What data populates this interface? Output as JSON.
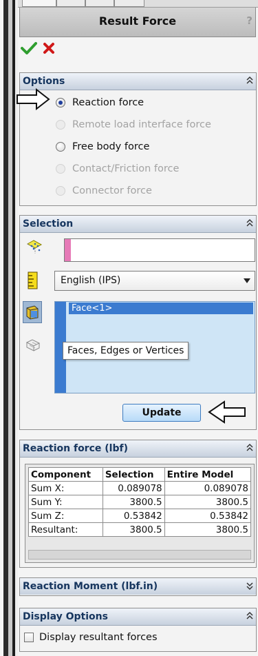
{
  "title_bar": {
    "title": "Result Force",
    "help": "?"
  },
  "actions": {
    "ok": "ok-check-icon",
    "cancel": "cancel-x-icon"
  },
  "colors": {
    "ok": "#2f9e2f",
    "cancel": "#d01818",
    "header_text": "#16355e",
    "list_selected": "#3b7bd0",
    "list_bg": "#cfe5f6",
    "pink": "#e67ab7"
  },
  "options": {
    "header": "Options",
    "items": [
      {
        "label": "Reaction force",
        "checked": true,
        "enabled": true
      },
      {
        "label": "Remote load interface force",
        "checked": false,
        "enabled": false
      },
      {
        "label": "Free body force",
        "checked": false,
        "enabled": true
      },
      {
        "label": "Contact/Friction force",
        "checked": false,
        "enabled": false
      },
      {
        "label": "Connector force",
        "checked": false,
        "enabled": false
      }
    ]
  },
  "selection": {
    "header": "Selection",
    "entity_value": "",
    "units": "English (IPS)",
    "list_items": [
      "Face<1>"
    ],
    "tooltip": "Faces, Edges or Vertices",
    "update_button": "Update"
  },
  "reaction_force": {
    "header": "Reaction force (lbf)",
    "columns": [
      "Component",
      "Selection",
      "Entire Model"
    ],
    "rows": [
      [
        "Sum X:",
        "0.089078",
        "0.089078"
      ],
      [
        "Sum Y:",
        "3800.5",
        "3800.5"
      ],
      [
        "Sum Z:",
        "0.53842",
        "0.53842"
      ],
      [
        "Resultant:",
        "3800.5",
        "3800.5"
      ]
    ]
  },
  "reaction_moment": {
    "header": "Reaction Moment (lbf.in)"
  },
  "display_options": {
    "header": "Display Options",
    "checkbox_label": "Display resultant forces",
    "checked": false
  }
}
